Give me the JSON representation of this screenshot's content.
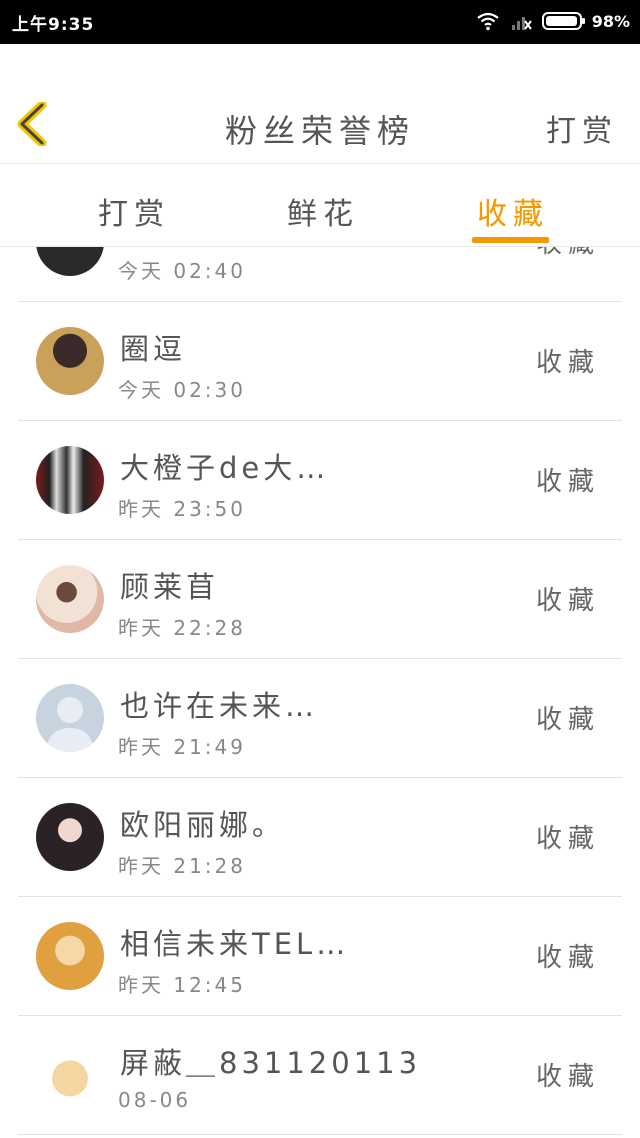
{
  "status_bar": {
    "time": "上午9:35",
    "battery_text": "98%",
    "battery_level": 0.98
  },
  "header": {
    "back_icon": "chevron-left-icon",
    "title": "粉丝荣誉榜",
    "right_action": "打赏"
  },
  "tabs": [
    {
      "label": "打赏",
      "active": false
    },
    {
      "label": "鲜花",
      "active": false
    },
    {
      "label": "收藏",
      "active": true
    }
  ],
  "accent_color": "#f39800",
  "rows": [
    {
      "name": "",
      "time": "今天 02:40",
      "action": "收藏",
      "avatar_color": "#2a2a2a"
    },
    {
      "name": "圈逗",
      "time": "今天 02:30",
      "action": "收藏",
      "avatar_color": "#c9a15a"
    },
    {
      "name": "大橙子de大…",
      "time": "昨天 23:50",
      "action": "收藏",
      "avatar_color": "#7a1a1a"
    },
    {
      "name": "顾莱苜",
      "time": "昨天 22:28",
      "action": "收藏",
      "avatar_color": "#e8d0c0"
    },
    {
      "name": "也许在未来…",
      "time": "昨天 21:49",
      "action": "收藏",
      "avatar_color": "#c8d3e0"
    },
    {
      "name": "欧阳丽娜。",
      "time": "昨天 21:28",
      "action": "收藏",
      "avatar_color": "#3a2f35"
    },
    {
      "name": "相信未来TEL…",
      "time": "昨天 12:45",
      "action": "收藏",
      "avatar_color": "#e0a040"
    },
    {
      "name": "屏蔽＿831120113",
      "time": "08-06",
      "action": "收藏",
      "avatar_color": "#f5d5a0"
    }
  ]
}
